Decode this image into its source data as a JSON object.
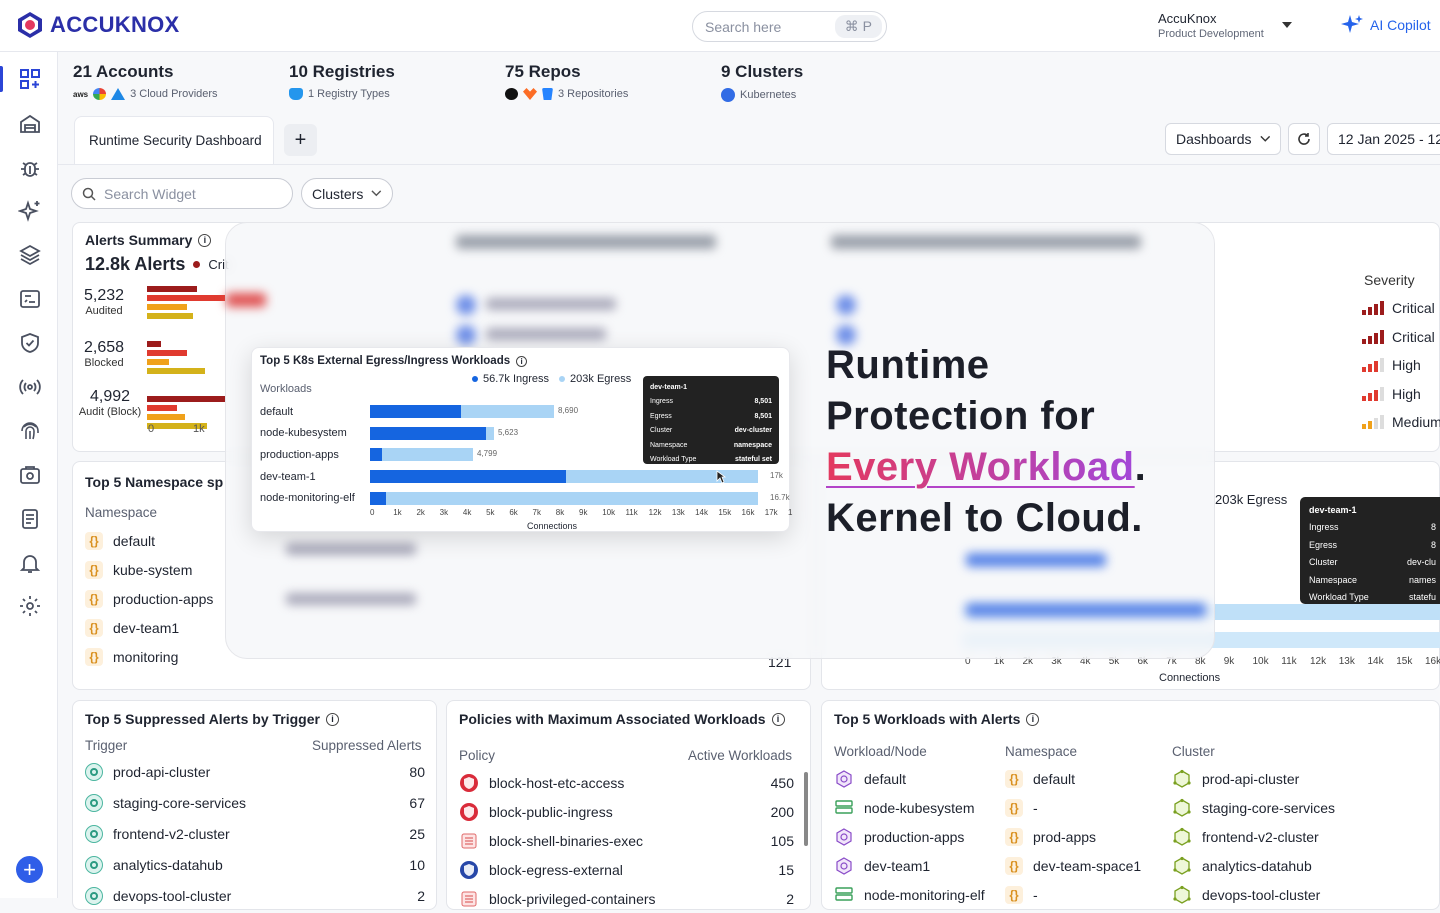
{
  "brand": {
    "name": "ACCUKNOX",
    "logo_icon": "accuknox-logo-icon"
  },
  "search": {
    "placeholder": "Search here",
    "shortcut": "⌘ P"
  },
  "org": {
    "name": "AccuKnox",
    "subtitle": "Product Development"
  },
  "copilot": {
    "label": "AI Copilot"
  },
  "sidebar": {
    "items": [
      "dashboard-icon",
      "inventory-icon",
      "bug-icon",
      "ai-sparkle-icon",
      "layers-icon",
      "remediation-icon",
      "shield-icon",
      "runtime-icon",
      "fingerprint-icon",
      "compliance-icon",
      "reports-icon",
      "bell-icon",
      "settings-icon"
    ],
    "add": "+"
  },
  "stats": [
    {
      "title": "21 Accounts",
      "sub": "3 Cloud Providers",
      "icons": [
        "aws",
        "gcp",
        "azure"
      ]
    },
    {
      "title": "10 Registries",
      "sub": "1 Registry Types",
      "icons": [
        "docker"
      ]
    },
    {
      "title": "75 Repos",
      "sub": "3 Repositories",
      "icons": [
        "github",
        "gitlab",
        "bitbucket"
      ]
    },
    {
      "title": "9 Clusters",
      "sub": "Kubernetes",
      "icons": [
        "kubernetes"
      ]
    }
  ],
  "tabs": {
    "active": "Runtime Security Dashboard",
    "add": "+"
  },
  "toolbar": {
    "dashboards": "Dashboards",
    "date": "12 Jan 2025 - 12"
  },
  "filters": {
    "widget_search_placeholder": "Search Widget",
    "clusters": "Clusters"
  },
  "alerts_summary": {
    "title": "Alerts Summary",
    "total": "12.8k Alerts",
    "legend_first": "Crit",
    "rows": [
      {
        "value": "5,232",
        "label": "Audited"
      },
      {
        "value": "2,658",
        "label": "Blocked"
      },
      {
        "value": "4,992",
        "label": "Audit (Block)"
      }
    ],
    "axis": [
      "0",
      "1k"
    ]
  },
  "severity": {
    "title": "Severity",
    "items": [
      {
        "label": "Critical",
        "color": "#9c1c1c"
      },
      {
        "label": "Critical",
        "color": "#9c1c1c"
      },
      {
        "label": "High",
        "color": "#e03a2f"
      },
      {
        "label": "High",
        "color": "#e03a2f"
      },
      {
        "label": "Medium",
        "color": "#f0a11a"
      }
    ]
  },
  "namespace_card": {
    "title": "Top 5 Namespace sp",
    "col": "Namespace",
    "rows": [
      "default",
      "kube-system",
      "production-apps",
      "dev-team1",
      "monitoring"
    ],
    "last_value": "121"
  },
  "popup": {
    "title": "Top 5 K8s External Egress/Ingress Workloads",
    "legend": [
      {
        "label": "56.7k Ingress",
        "color": "#1565e0"
      },
      {
        "label": "203k Egress",
        "color": "#a9d4f5"
      }
    ],
    "col": "Workloads",
    "xlabel": "Connections",
    "ticks": [
      "0",
      "1k",
      "2k",
      "3k",
      "4k",
      "5k",
      "6k",
      "7k",
      "8k",
      "9k",
      "10k",
      "11k",
      "12k",
      "13k",
      "14k",
      "15k",
      "16k",
      "17k",
      "1"
    ],
    "rows": [
      {
        "name": "default",
        "ingress": 0.235,
        "egress": 0.475,
        "label": "8,690"
      },
      {
        "name": "node-kubesystem",
        "ingress": 0.3,
        "egress": 0.32,
        "label": "5,623"
      },
      {
        "name": "production-apps",
        "ingress": 0.03,
        "egress": 0.265,
        "label": "4,799"
      },
      {
        "name": "dev-team-1",
        "ingress": 0.505,
        "egress": 1.0,
        "label": "17k"
      },
      {
        "name": "node-monitoring-elf",
        "ingress": 0.04,
        "egress": 1.0,
        "label": "16.7k"
      }
    ],
    "tooltip": {
      "title": "dev-team-1",
      "rows": [
        [
          "Ingress",
          "8,501"
        ],
        [
          "Egress",
          "8,501"
        ],
        [
          "Cluster",
          "dev-cluster"
        ],
        [
          "Namespace",
          "namespace"
        ],
        [
          "Workload Type",
          "stateful set"
        ]
      ]
    }
  },
  "hero": {
    "line1": "Runtime",
    "line2": "Protection for",
    "line3a": "Every Workload",
    "line3b": ".",
    "line4": "Kernel to Cloud."
  },
  "right_chart": {
    "legend": "203k Egress",
    "xlabel": "Connections",
    "ticks": [
      "0",
      "1k",
      "2k",
      "3k",
      "4k",
      "5k",
      "6k",
      "7k",
      "8k",
      "9k",
      "10k",
      "11k",
      "12k",
      "13k",
      "14k",
      "15k",
      "16k"
    ],
    "tooltip": {
      "title": "dev-team-1",
      "rows": [
        [
          "Ingress",
          "8"
        ],
        [
          "Egress",
          "8"
        ],
        [
          "Cluster",
          "dev-clu"
        ],
        [
          "Namespace",
          "names"
        ],
        [
          "Workload Type",
          "statefu"
        ]
      ]
    }
  },
  "suppressed": {
    "title": "Top 5 Suppressed Alerts by Trigger",
    "cols": [
      "Trigger",
      "Suppressed Alerts"
    ],
    "rows": [
      {
        "name": "prod-api-cluster",
        "value": "80"
      },
      {
        "name": "staging-core-services",
        "value": "67"
      },
      {
        "name": "frontend-v2-cluster",
        "value": "25"
      },
      {
        "name": "analytics-datahub",
        "value": "10"
      },
      {
        "name": "devops-tool-cluster",
        "value": "2"
      }
    ]
  },
  "policies": {
    "title": "Policies with Maximum Associated Workloads",
    "cols": [
      "Policy",
      "Active Workloads"
    ],
    "rows": [
      {
        "name": "block-host-etc-access",
        "value": "450",
        "icon": "red-shield"
      },
      {
        "name": "block-public-ingress",
        "value": "200",
        "icon": "red-shield"
      },
      {
        "name": "block-shell-binaries-exec",
        "value": "105",
        "icon": "list"
      },
      {
        "name": "block-egress-external",
        "value": "15",
        "icon": "blue-shield"
      },
      {
        "name": "block-privileged-containers",
        "value": "2",
        "icon": "list"
      }
    ]
  },
  "workloads": {
    "title": "Top 5 Workloads with Alerts",
    "cols": [
      "Workload/Node",
      "Namespace",
      "Cluster"
    ],
    "rows": [
      {
        "w": "default",
        "ns": "default",
        "c": "prod-api-cluster"
      },
      {
        "w": "node-kubesystem",
        "ns": "-",
        "c": "staging-core-services"
      },
      {
        "w": "production-apps",
        "ns": "prod-apps",
        "c": "frontend-v2-cluster"
      },
      {
        "w": "dev-team1",
        "ns": "dev-team-space1",
        "c": "analytics-datahub"
      },
      {
        "w": "node-monitoring-elf",
        "ns": "-",
        "c": "devops-tool-cluster"
      }
    ]
  }
}
